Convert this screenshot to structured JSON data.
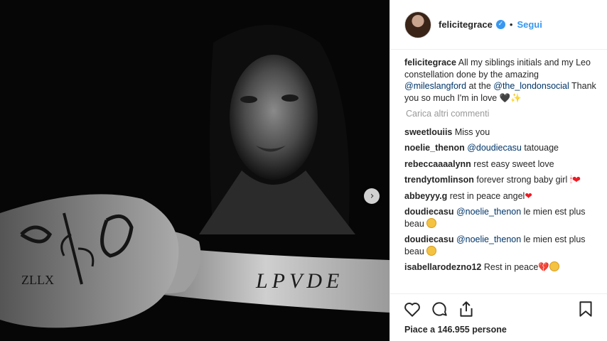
{
  "post": {
    "username": "felicitegrace",
    "follow_label": "Segui",
    "dot": "•",
    "verified_mark": "✓",
    "next_arrow": "›"
  },
  "caption": {
    "username": "felicitegrace",
    "text_1": " All my siblings initials and my Leo constellation done by the amazing ",
    "mention_1": "@mileslangford",
    "text_2": " at the ",
    "mention_2": "@the_londonsocial",
    "text_3": " Thank you so much I'm in love ",
    "emoji": "🖤✨"
  },
  "load_more": "Carica altri commenti",
  "comments": [
    {
      "user": "sweetlouiis",
      "text": " Miss you"
    },
    {
      "user": "noelie_thenon",
      "mention": "@doudiecasu",
      "text": " tatouage"
    },
    {
      "user": "rebeccaaaalynn",
      "text": " rest easy sweet love"
    },
    {
      "user": "trendytomlinson",
      "text": " forever strong baby girl ",
      "emoji": "🕯❤"
    },
    {
      "user": "abbeyyy.g",
      "text": " rest in peace angel",
      "emoji": "❤"
    },
    {
      "user": "doudiecasu",
      "mention": "@noelie_thenon",
      "text": " le mien est plus beau "
    },
    {
      "user": "doudiecasu",
      "mention": "@noelie_thenon",
      "text": " le mien est plus beau "
    },
    {
      "user": "isabellarodezno12",
      "text": " Rest in peace",
      "emoji": "💔"
    }
  ],
  "likes_text": "Piace a 146.955 persone",
  "icons": [
    "heart-icon",
    "comment-icon",
    "share-icon",
    "bookmark-icon"
  ]
}
